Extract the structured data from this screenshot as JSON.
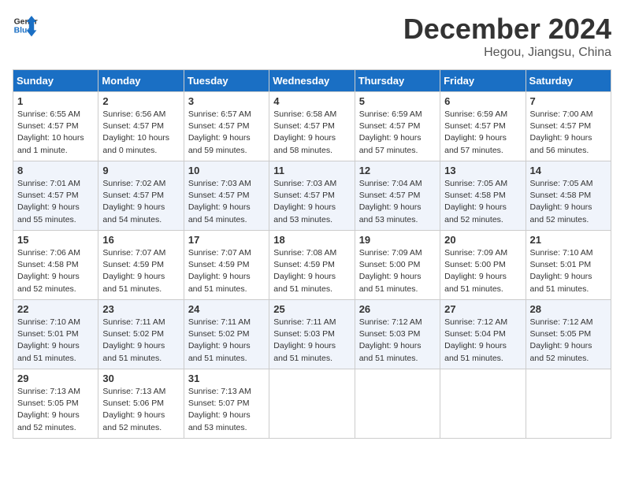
{
  "logo": {
    "line1": "General",
    "line2": "Blue"
  },
  "title": "December 2024",
  "location": "Hegou, Jiangsu, China",
  "days_of_week": [
    "Sunday",
    "Monday",
    "Tuesday",
    "Wednesday",
    "Thursday",
    "Friday",
    "Saturday"
  ],
  "weeks": [
    [
      {
        "day": "1",
        "sunrise": "6:55 AM",
        "sunset": "4:57 PM",
        "daylight": "10 hours and 1 minute."
      },
      {
        "day": "2",
        "sunrise": "6:56 AM",
        "sunset": "4:57 PM",
        "daylight": "10 hours and 0 minutes."
      },
      {
        "day": "3",
        "sunrise": "6:57 AM",
        "sunset": "4:57 PM",
        "daylight": "9 hours and 59 minutes."
      },
      {
        "day": "4",
        "sunrise": "6:58 AM",
        "sunset": "4:57 PM",
        "daylight": "9 hours and 58 minutes."
      },
      {
        "day": "5",
        "sunrise": "6:59 AM",
        "sunset": "4:57 PM",
        "daylight": "9 hours and 57 minutes."
      },
      {
        "day": "6",
        "sunrise": "6:59 AM",
        "sunset": "4:57 PM",
        "daylight": "9 hours and 57 minutes."
      },
      {
        "day": "7",
        "sunrise": "7:00 AM",
        "sunset": "4:57 PM",
        "daylight": "9 hours and 56 minutes."
      }
    ],
    [
      {
        "day": "8",
        "sunrise": "7:01 AM",
        "sunset": "4:57 PM",
        "daylight": "9 hours and 55 minutes."
      },
      {
        "day": "9",
        "sunrise": "7:02 AM",
        "sunset": "4:57 PM",
        "daylight": "9 hours and 54 minutes."
      },
      {
        "day": "10",
        "sunrise": "7:03 AM",
        "sunset": "4:57 PM",
        "daylight": "9 hours and 54 minutes."
      },
      {
        "day": "11",
        "sunrise": "7:03 AM",
        "sunset": "4:57 PM",
        "daylight": "9 hours and 53 minutes."
      },
      {
        "day": "12",
        "sunrise": "7:04 AM",
        "sunset": "4:57 PM",
        "daylight": "9 hours and 53 minutes."
      },
      {
        "day": "13",
        "sunrise": "7:05 AM",
        "sunset": "4:58 PM",
        "daylight": "9 hours and 52 minutes."
      },
      {
        "day": "14",
        "sunrise": "7:05 AM",
        "sunset": "4:58 PM",
        "daylight": "9 hours and 52 minutes."
      }
    ],
    [
      {
        "day": "15",
        "sunrise": "7:06 AM",
        "sunset": "4:58 PM",
        "daylight": "9 hours and 52 minutes."
      },
      {
        "day": "16",
        "sunrise": "7:07 AM",
        "sunset": "4:59 PM",
        "daylight": "9 hours and 51 minutes."
      },
      {
        "day": "17",
        "sunrise": "7:07 AM",
        "sunset": "4:59 PM",
        "daylight": "9 hours and 51 minutes."
      },
      {
        "day": "18",
        "sunrise": "7:08 AM",
        "sunset": "4:59 PM",
        "daylight": "9 hours and 51 minutes."
      },
      {
        "day": "19",
        "sunrise": "7:09 AM",
        "sunset": "5:00 PM",
        "daylight": "9 hours and 51 minutes."
      },
      {
        "day": "20",
        "sunrise": "7:09 AM",
        "sunset": "5:00 PM",
        "daylight": "9 hours and 51 minutes."
      },
      {
        "day": "21",
        "sunrise": "7:10 AM",
        "sunset": "5:01 PM",
        "daylight": "9 hours and 51 minutes."
      }
    ],
    [
      {
        "day": "22",
        "sunrise": "7:10 AM",
        "sunset": "5:01 PM",
        "daylight": "9 hours and 51 minutes."
      },
      {
        "day": "23",
        "sunrise": "7:11 AM",
        "sunset": "5:02 PM",
        "daylight": "9 hours and 51 minutes."
      },
      {
        "day": "24",
        "sunrise": "7:11 AM",
        "sunset": "5:02 PM",
        "daylight": "9 hours and 51 minutes."
      },
      {
        "day": "25",
        "sunrise": "7:11 AM",
        "sunset": "5:03 PM",
        "daylight": "9 hours and 51 minutes."
      },
      {
        "day": "26",
        "sunrise": "7:12 AM",
        "sunset": "5:03 PM",
        "daylight": "9 hours and 51 minutes."
      },
      {
        "day": "27",
        "sunrise": "7:12 AM",
        "sunset": "5:04 PM",
        "daylight": "9 hours and 51 minutes."
      },
      {
        "day": "28",
        "sunrise": "7:12 AM",
        "sunset": "5:05 PM",
        "daylight": "9 hours and 52 minutes."
      }
    ],
    [
      {
        "day": "29",
        "sunrise": "7:13 AM",
        "sunset": "5:05 PM",
        "daylight": "9 hours and 52 minutes."
      },
      {
        "day": "30",
        "sunrise": "7:13 AM",
        "sunset": "5:06 PM",
        "daylight": "9 hours and 52 minutes."
      },
      {
        "day": "31",
        "sunrise": "7:13 AM",
        "sunset": "5:07 PM",
        "daylight": "9 hours and 53 minutes."
      },
      null,
      null,
      null,
      null
    ]
  ]
}
